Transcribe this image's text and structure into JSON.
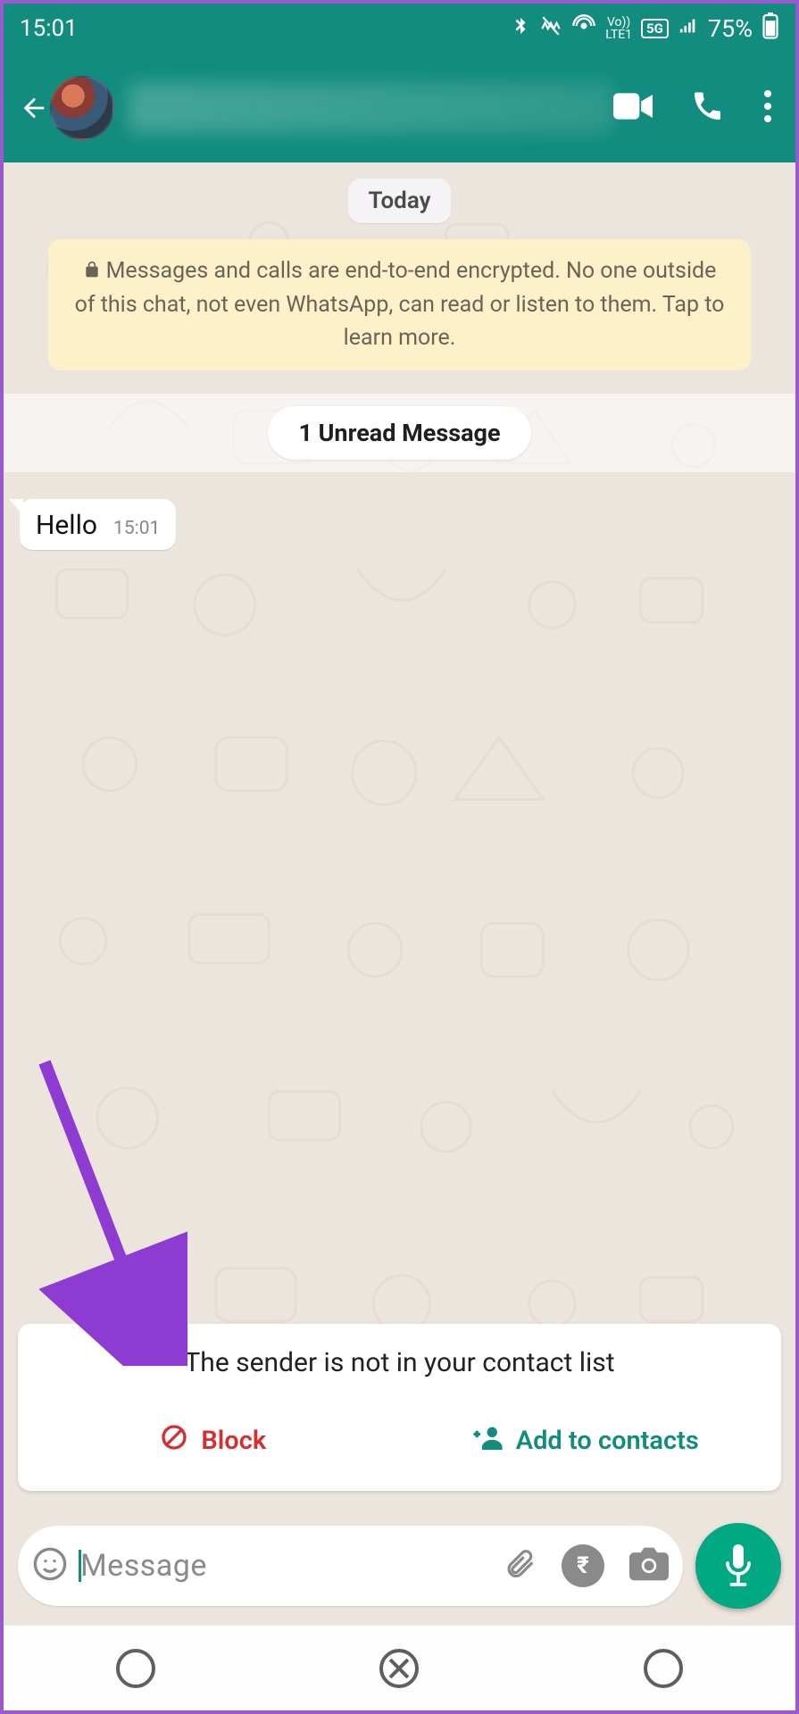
{
  "statusbar": {
    "time": "15:01",
    "network_label": "LTE1",
    "network_badge": "5G",
    "signal_icon": "signal-icon",
    "battery_pct": "75%"
  },
  "chat": {
    "date_label": "Today",
    "encryption_notice": "Messages and calls are end-to-end encrypted. No one outside of this chat, not even WhatsApp, can read or listen to them. Tap to learn more.",
    "unread_label": "1 Unread Message",
    "messages": [
      {
        "text": "Hello",
        "time": "15:01",
        "incoming": true
      }
    ]
  },
  "spam_card": {
    "text": "The sender is not in your contact list",
    "block_label": "Block",
    "add_label": "Add to contacts"
  },
  "compose": {
    "placeholder": "Message"
  },
  "status_carrier": "Vo))"
}
